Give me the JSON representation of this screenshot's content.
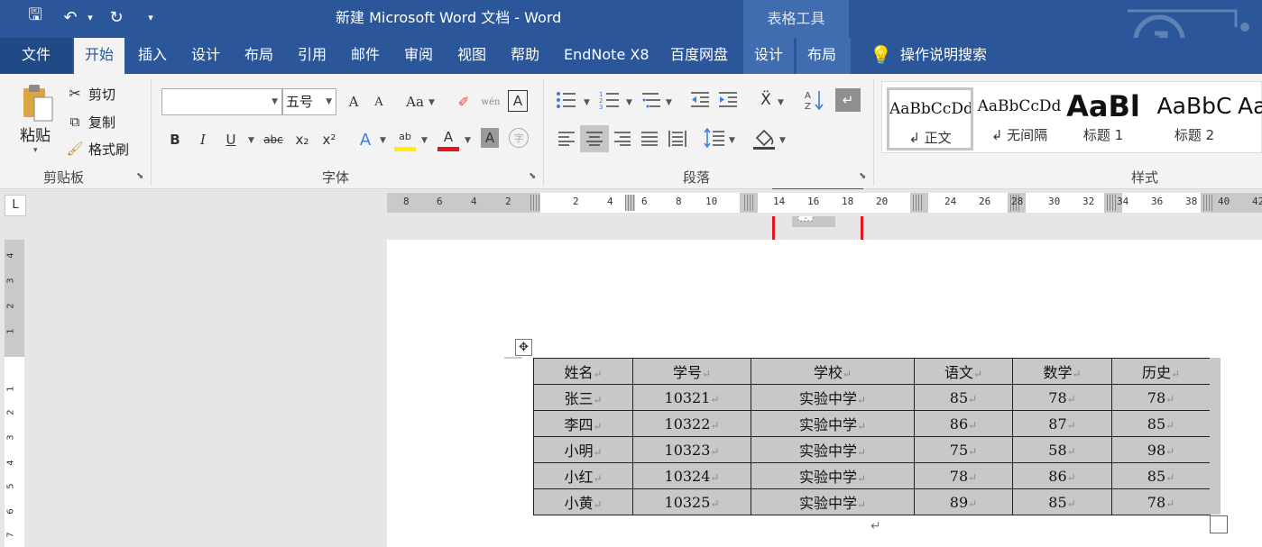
{
  "titlebar": {
    "title": "新建 Microsoft Word 文档  -  Word",
    "contextual_label": "表格工具",
    "qat": {
      "save": "🖫",
      "undo": "↶",
      "undo_dd": "▾",
      "redo": "↻",
      "customize": "▾"
    }
  },
  "tabs": [
    {
      "label": "文件"
    },
    {
      "label": "开始"
    },
    {
      "label": "插入"
    },
    {
      "label": "设计"
    },
    {
      "label": "布局"
    },
    {
      "label": "引用"
    },
    {
      "label": "邮件"
    },
    {
      "label": "审阅"
    },
    {
      "label": "视图"
    },
    {
      "label": "帮助"
    },
    {
      "label": "EndNote X8"
    },
    {
      "label": "百度网盘"
    },
    {
      "label": "设计"
    },
    {
      "label": "布局"
    }
  ],
  "tell_me": {
    "icon": "💡",
    "label": "操作说明搜索"
  },
  "clipboard": {
    "paste": "粘贴",
    "cut": "剪切",
    "copy": "复制",
    "format_painter": "格式刷",
    "group_label": "剪贴板"
  },
  "font": {
    "font_name_value": "",
    "font_size_value": "五号",
    "group_label": "字体",
    "grow": "A",
    "shrink": "A",
    "case": "Aa",
    "phonetic": "wén",
    "bold": "B",
    "italic": "I",
    "underline": "U",
    "strike": "abc",
    "sub": "x₂",
    "sup": "x²",
    "effects": "A",
    "highlight": "ab",
    "color": "A",
    "shading": "A",
    "enclose": "字"
  },
  "paragraph": {
    "group_label": "段落"
  },
  "styles": {
    "group_label": "样式",
    "items": [
      {
        "preview": "AaBbCcDd",
        "name": "↲ 正文"
      },
      {
        "preview": "AaBbCcDd",
        "name": "↲ 无间隔"
      },
      {
        "preview": "AaBl",
        "name": "标题 1"
      },
      {
        "preview": "AaBbC",
        "name": "标题 2"
      },
      {
        "preview": "Aa",
        "name": ""
      }
    ]
  },
  "ruler": {
    "h_numbers": [
      "8",
      "6",
      "4",
      "2",
      "2",
      "4",
      "6",
      "8",
      "10",
      "14",
      "16",
      "18",
      "20",
      "24",
      "26",
      "28",
      "30",
      "32",
      "34",
      "36",
      "38",
      "40",
      "42"
    ],
    "v_numbers": [
      "4",
      "3",
      "2",
      "1",
      "1",
      "2",
      "3",
      "4",
      "5",
      "6",
      "7"
    ],
    "tab_selector": "L"
  },
  "table": {
    "headers": [
      "姓名",
      "学号",
      "学校",
      "语文",
      "数学",
      "历史"
    ],
    "rows": [
      [
        "张三",
        "10321",
        "实验中学",
        "85",
        "78",
        "78"
      ],
      [
        "李四",
        "10322",
        "实验中学",
        "86",
        "87",
        "85"
      ],
      [
        "小明",
        "10323",
        "实验中学",
        "75",
        "58",
        "98"
      ],
      [
        "小红",
        "10324",
        "实验中学",
        "78",
        "86",
        "85"
      ],
      [
        "小黄",
        "10325",
        "实验中学",
        "89",
        "85",
        "78"
      ]
    ],
    "cell_mark": "↵",
    "para_mark": "↵",
    "move_handle": "✥"
  },
  "colors": {
    "title_bg": "#2b579a",
    "contextual_bg": "#3f6daf",
    "highlight": "#e0181e",
    "cell_shading": "#c8c8c8"
  }
}
